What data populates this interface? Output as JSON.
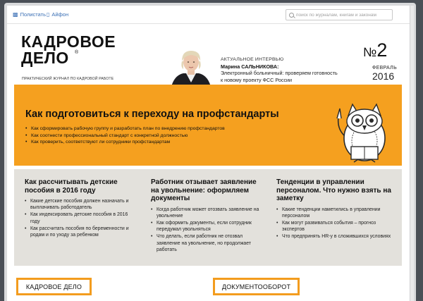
{
  "topbar": {
    "links": [
      {
        "label": "Полистать",
        "icon": "monitor-icon"
      },
      {
        "label": "Айфон",
        "icon": "phone-icon"
      }
    ],
    "search_placeholder": "поиск по журналам, книгам и законам"
  },
  "masthead": {
    "title": "КАДРОВОЕ\nДЕЛО",
    "registered": "®",
    "subtitle": "ПРАКТИЧЕСКИЙ ЖУРНАЛ ПО КАДРОВОЙ РАБОТЕ",
    "interview": {
      "kicker": "АКТУАЛЬНОЕ ИНТЕРВЬЮ",
      "name": "Марина САЛЬНИКОВА:",
      "text": "Электронный больничный: проверяем готовность к новому проекту ФСС России"
    },
    "issue": {
      "number": "2",
      "prefix": "№",
      "month": "ФЕВРАЛЬ",
      "year": "2016"
    }
  },
  "feature": {
    "title": "Как подготовиться к переходу на профстандарты",
    "items": [
      "Как сформировать рабочую группу и разработать план по внедрению профстандартов",
      "Как соотнести профессиональный стандарт с конкретной должностью",
      "Как проверить, соответствуют ли сотрудники профстандартам"
    ],
    "colors": {
      "background": "#f5a01f"
    }
  },
  "columns": [
    {
      "title": "Как рассчитывать детские пособия в 2016 году",
      "items": [
        "Какие детские пособия должен назначать и выплачивать работодатель",
        "Как индексировать детские пособия в 2016 году",
        "Как рассчитать пособия по беременности и родам и по уходу за ребенком"
      ]
    },
    {
      "title": "Работник отзывает заявление на увольнение: оформляем документы",
      "items": [
        "Когда работник может отозвать заявление на увольнение",
        "Как оформить документы, если сотрудник передумал увольняться",
        "Что делать, если работник не отозвал заявление на увольнение, но продолжает работать"
      ]
    },
    {
      "title": "Тенденции в управлении персоналом. Что нужно взять на заметку",
      "items": [
        "Какие тенденции наметились в управлении персоналом",
        "Как могут развиваться события – прогноз экспертов",
        "Что предпринять HR-у в сложившихся условиях"
      ]
    }
  ],
  "buttons": [
    {
      "label": "КАДРОВОЕ ДЕЛО"
    },
    {
      "label": "ДОКУМЕНТООБОРОТ"
    }
  ],
  "colors": {
    "accent": "#f39c1e",
    "panel": "#e3e1dc",
    "link": "#3a6fb5"
  }
}
